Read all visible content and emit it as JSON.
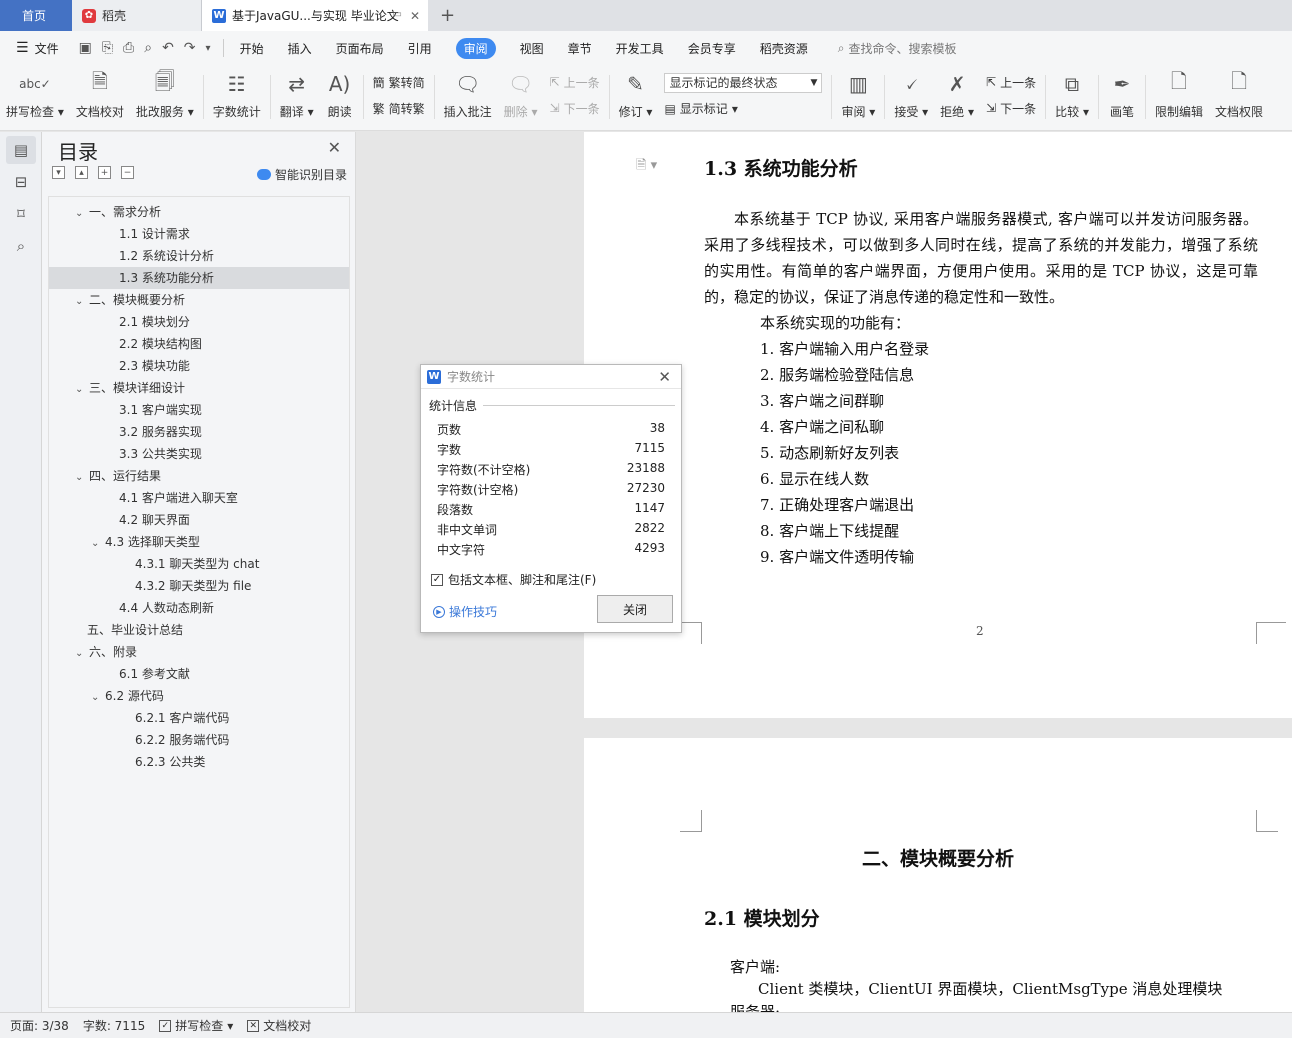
{
  "tabs": {
    "home": "首页",
    "wps": "稻壳",
    "doc": "基于JavaGU...与实现 毕业论文"
  },
  "menu": {
    "file": "文件",
    "items": [
      "开始",
      "插入",
      "页面布局",
      "引用",
      "审阅",
      "视图",
      "章节",
      "开发工具",
      "会员专享",
      "稻壳资源"
    ],
    "active": "审阅",
    "search_placeholder": "查找命令、搜索模板"
  },
  "ribbon": {
    "spell": "拼写检查",
    "proof": "文档校对",
    "approve": "批改服务",
    "wordcount": "字数统计",
    "translate": "翻译",
    "read": "朗读",
    "trad_simp": "繁转简",
    "simp_trad": "简转繁",
    "insert_comment": "插入批注",
    "delete": "删除",
    "prev": "上一条",
    "next": "下一条",
    "revise": "修订",
    "markup_select": "显示标记的最终状态",
    "show_markup": "显示标记",
    "review": "审阅",
    "accept": "接受",
    "reject": "拒绝",
    "prev2": "上一条",
    "next2": "下一条",
    "compare": "比较",
    "pen": "画笔",
    "restrict": "限制编辑",
    "permission": "文档权限"
  },
  "toc": {
    "title": "目录",
    "smart": "智能识别目录",
    "items": [
      {
        "text": "一、需求分析",
        "level": 1,
        "arrow": true
      },
      {
        "text": "1.1  设计需求",
        "level": 2
      },
      {
        "text": "1.2  系统设计分析",
        "level": 2
      },
      {
        "text": "1.3  系统功能分析",
        "level": 2,
        "selected": true
      },
      {
        "text": "二、模块概要分析",
        "level": 1,
        "arrow": true
      },
      {
        "text": "2.1  模块划分",
        "level": 2
      },
      {
        "text": "2.2  模块结构图",
        "level": 2
      },
      {
        "text": "2.3  模块功能",
        "level": 2
      },
      {
        "text": "三、模块详细设计",
        "level": 1,
        "arrow": true
      },
      {
        "text": "3.1  客户端实现",
        "level": 2
      },
      {
        "text": "3.2  服务器实现",
        "level": 2
      },
      {
        "text": "3.3  公共类实现",
        "level": 2
      },
      {
        "text": "四、运行结果",
        "level": 1,
        "arrow": true
      },
      {
        "text": "4.1  客户端进入聊天室",
        "level": 2
      },
      {
        "text": "4.2  聊天界面",
        "level": 2
      },
      {
        "text": "4.3  选择聊天类型",
        "level": 2,
        "arrow": true
      },
      {
        "text": "4.3.1  聊天类型为 chat",
        "level": 3
      },
      {
        "text": "4.3.2  聊天类型为 file",
        "level": 3
      },
      {
        "text": "4.4  人数动态刷新",
        "level": 2
      },
      {
        "text": "五、毕业设计总结",
        "level": 1
      },
      {
        "text": "六、附录",
        "level": 1,
        "arrow": true
      },
      {
        "text": "6.1  参考文献",
        "level": 2
      },
      {
        "text": "6.2  源代码",
        "level": 2,
        "arrow": true
      },
      {
        "text": "6.2.1 客户端代码",
        "level": 3
      },
      {
        "text": "6.2.2 服务端代码",
        "level": 3
      },
      {
        "text": "6.2.3  公共类",
        "level": 3
      }
    ]
  },
  "doc": {
    "h_13": "1.3  系统功能分析",
    "para1": "本系统基于 TCP 协议, 采用客户端服务器模式, 客户端可以并发访问服务器。采用了多线程技术，可以做到多人同时在线，提高了系统的并发能力，增强了系统的实用性。有简单的客户端界面，方便用户使用。采用的是 TCP 协议，这是可靠的，稳定的协议，保证了消息传递的稳定性和一致性。",
    "intro": "本系统实现的功能有：",
    "features": [
      "1.   客户端输入用户名登录",
      "2.   服务端检验登陆信息",
      "3.   客户端之间群聊",
      "4.   客户端之间私聊",
      "5.   动态刷新好友列表",
      "6.   显示在线人数",
      "7.   正确处理客户端退出",
      "8.   客户端上下线提醒",
      "9.   客户端文件透明传输"
    ],
    "page_num": "2",
    "chapter2": "二、模块概要分析",
    "h_21": "2.1  模块划分",
    "client_label": "客户端:",
    "client_line": "Client 类模块，ClientUI 界面模块，ClientMsgType 消息处理模块",
    "server_label": "服务器:"
  },
  "dialog": {
    "title": "字数统计",
    "section": "统计信息",
    "stats": [
      {
        "label": "页数",
        "value": "38"
      },
      {
        "label": "字数",
        "value": "7115"
      },
      {
        "label": "字符数(不计空格)",
        "value": "23188"
      },
      {
        "label": "字符数(计空格)",
        "value": "27230"
      },
      {
        "label": "段落数",
        "value": "1147"
      },
      {
        "label": "非中文单词",
        "value": "2822"
      },
      {
        "label": "中文字符",
        "value": "4293"
      }
    ],
    "include": "包括文本框、脚注和尾注(F)",
    "tips": "操作技巧",
    "close": "关闭"
  },
  "status": {
    "page": "页面: 3/38",
    "words": "字数: 7115",
    "spell": "拼写检查",
    "proof": "文档校对"
  },
  "colors": {
    "accent": "#3e8af0",
    "home_tab": "#4472c4"
  }
}
